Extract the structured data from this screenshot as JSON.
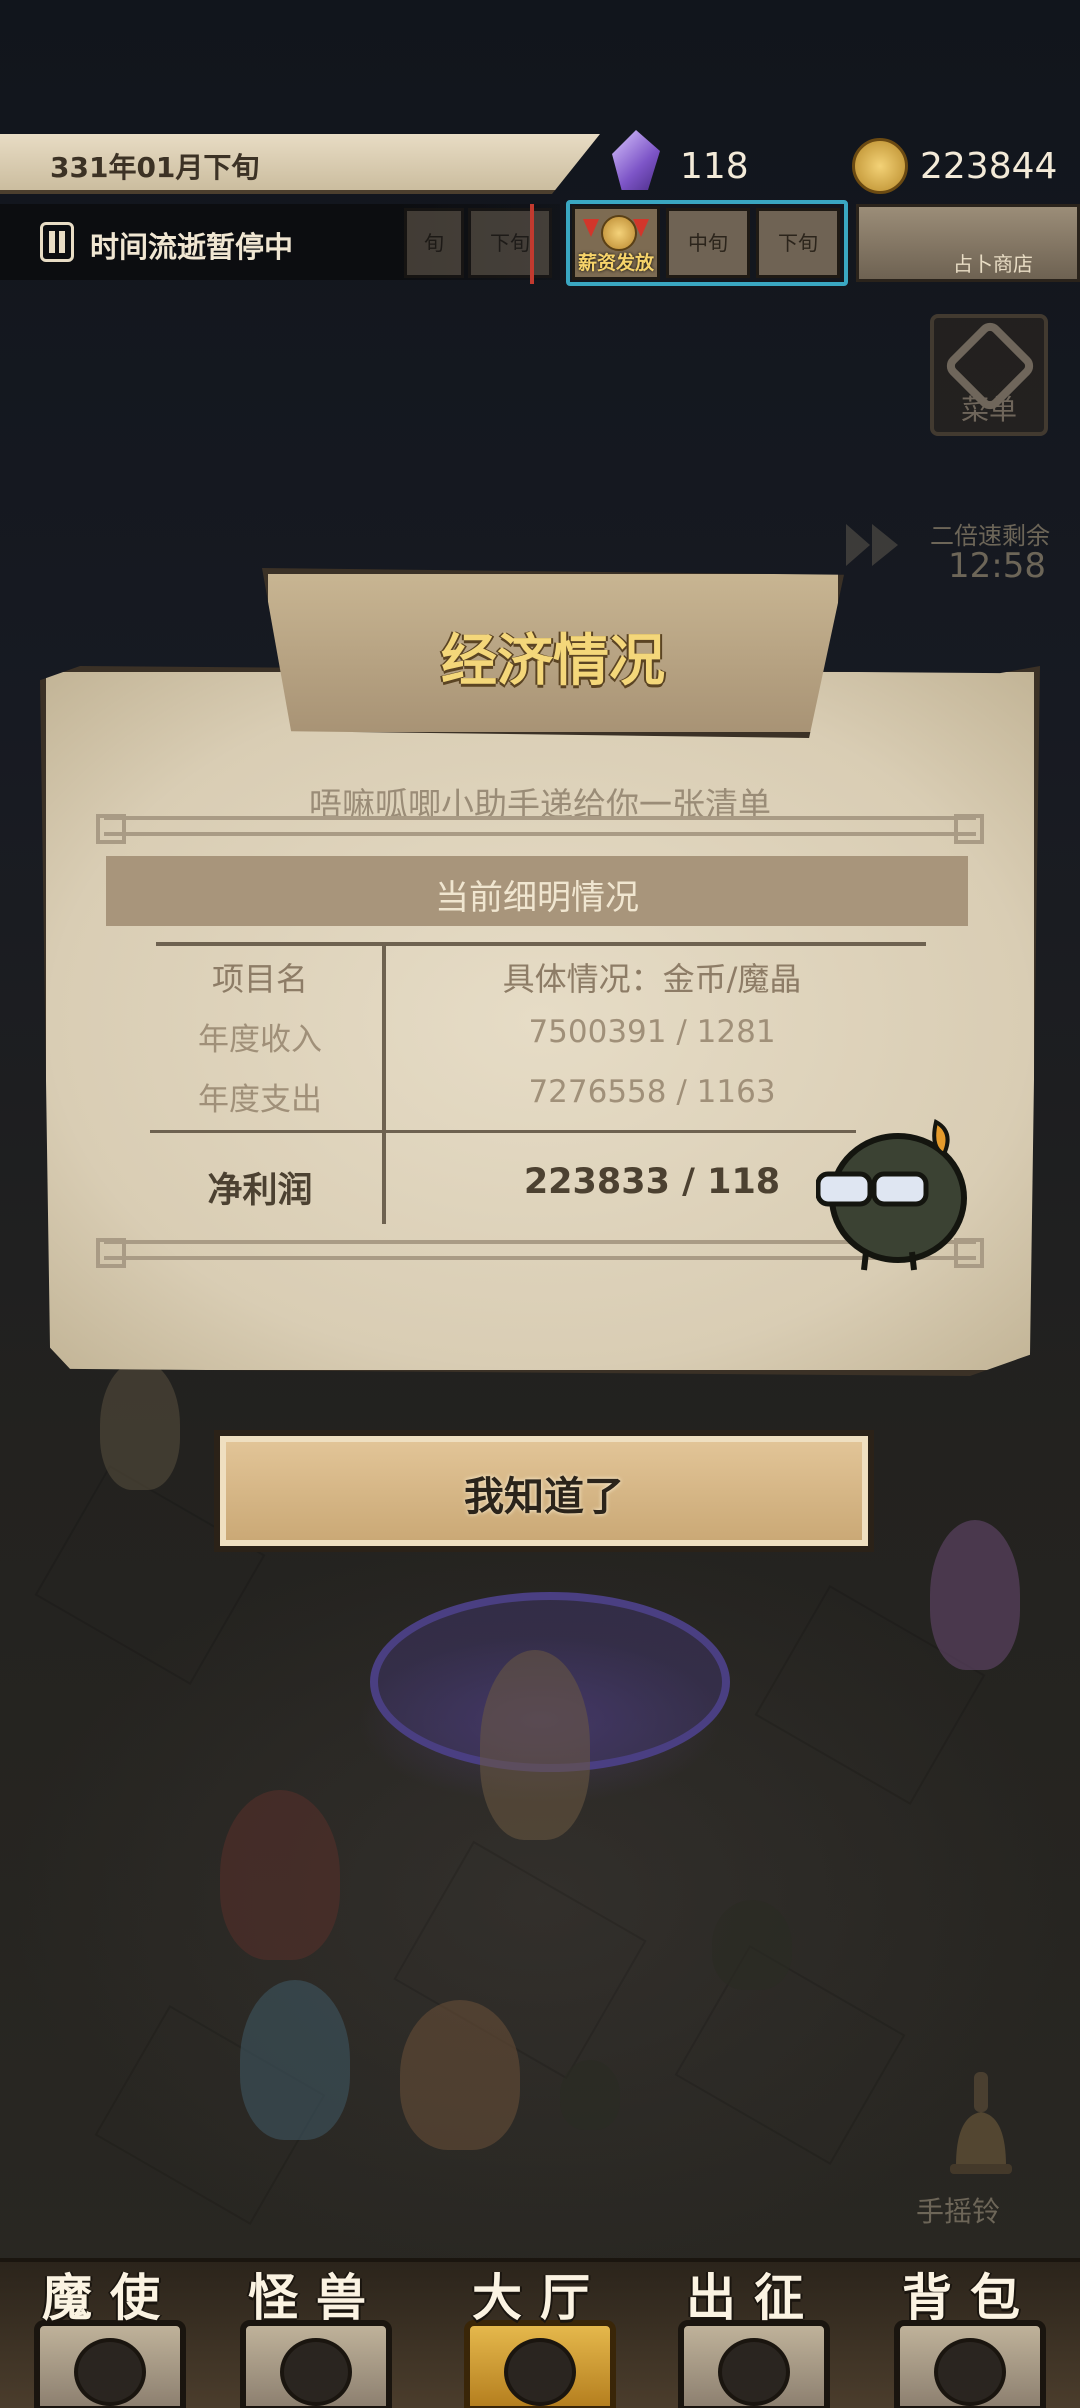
{
  "topbar": {
    "date": "331年01月下旬",
    "time_status": "时间流逝暂停中",
    "crystal_count": "118",
    "gold_count": "223844",
    "schedule_slots": [
      "旬",
      "下旬",
      "薪资发放",
      "中旬",
      "下旬"
    ],
    "shop_label": "占卜商店"
  },
  "side": {
    "menu_label": "菜单",
    "speed_label": "二倍速剩余",
    "speed_time": "12:58",
    "bell_label": "手摇铃"
  },
  "dialog": {
    "title": "经济情况",
    "subtitle": "唔嘛呱唧小助手递给你一张清单",
    "section": "当前细明情况",
    "table": {
      "col1_header": "项目名",
      "col2_header": "具体情况：金币/魔晶",
      "rows": [
        {
          "name": "年度收入",
          "value": "7500391 / 1281"
        },
        {
          "name": "年度支出",
          "value": "7276558 / 1163"
        }
      ],
      "net_label": "净利润",
      "net_value": "223833 / 118"
    },
    "confirm_label": "我知道了"
  },
  "bottom_nav": [
    {
      "label": "魔使",
      "icon": "skull-icon",
      "active": false
    },
    {
      "label": "怪兽",
      "icon": "monster-icon",
      "active": false
    },
    {
      "label": "大厅",
      "icon": "hall-icon",
      "active": true
    },
    {
      "label": "出征",
      "icon": "expedition-icon",
      "active": false
    },
    {
      "label": "背包",
      "icon": "backpack-icon",
      "active": false
    }
  ],
  "colors": {
    "parchment": "#d9cdb4",
    "title_gold": "#f4d77a",
    "accent_blue": "#3aa7c2",
    "dark": "#1a1c22"
  }
}
